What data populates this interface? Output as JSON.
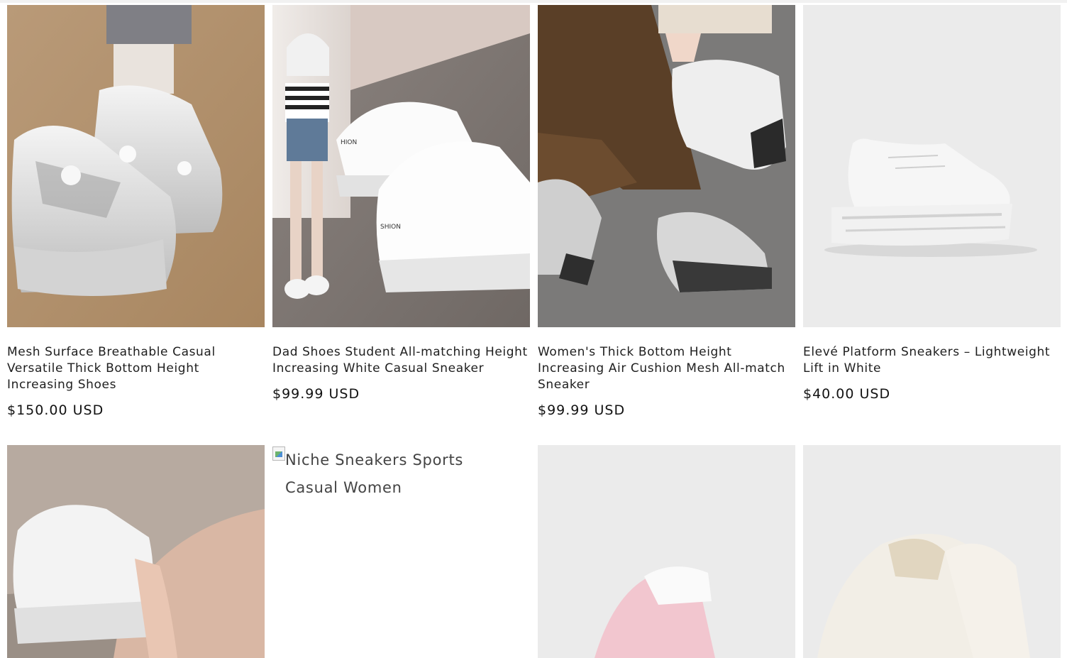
{
  "products": [
    {
      "title": "Mesh Surface Breathable Casual Versatile Thick Bottom Height Increasing Shoes",
      "price": "$150.00 USD",
      "image": "silver-chunky-sneakers-photo"
    },
    {
      "title": "Dad Shoes Student All-matching Height Increasing White Casual Sneaker",
      "price": "$99.99 USD",
      "image": "white-dad-shoes-photo",
      "image_text": "HION",
      "image_text_2": "SHION"
    },
    {
      "title": "Women's Thick Bottom Height Increasing Air Cushion Mesh All-match Sneaker",
      "price": "$99.99 USD",
      "image": "grey-mesh-sneakers-photo"
    },
    {
      "title": "Elevé Platform Sneakers – Lightweight Lift in White",
      "price": "$40.00 USD",
      "image": "white-platform-sneaker-photo"
    },
    {
      "title": "",
      "price": "",
      "image": "white-sneaker-on-foot-photo"
    },
    {
      "title": "",
      "price": "",
      "image": "broken-image",
      "image_alt": "Niche Sneakers Sports Casual Women"
    },
    {
      "title": "",
      "price": "",
      "image": "pink-sneaker-photo"
    },
    {
      "title": "",
      "price": "",
      "image": "cream-sneaker-photo"
    }
  ],
  "colors": {
    "text": "#121212",
    "background": "#ffffff",
    "media_bg_light": "#ebebeb"
  }
}
